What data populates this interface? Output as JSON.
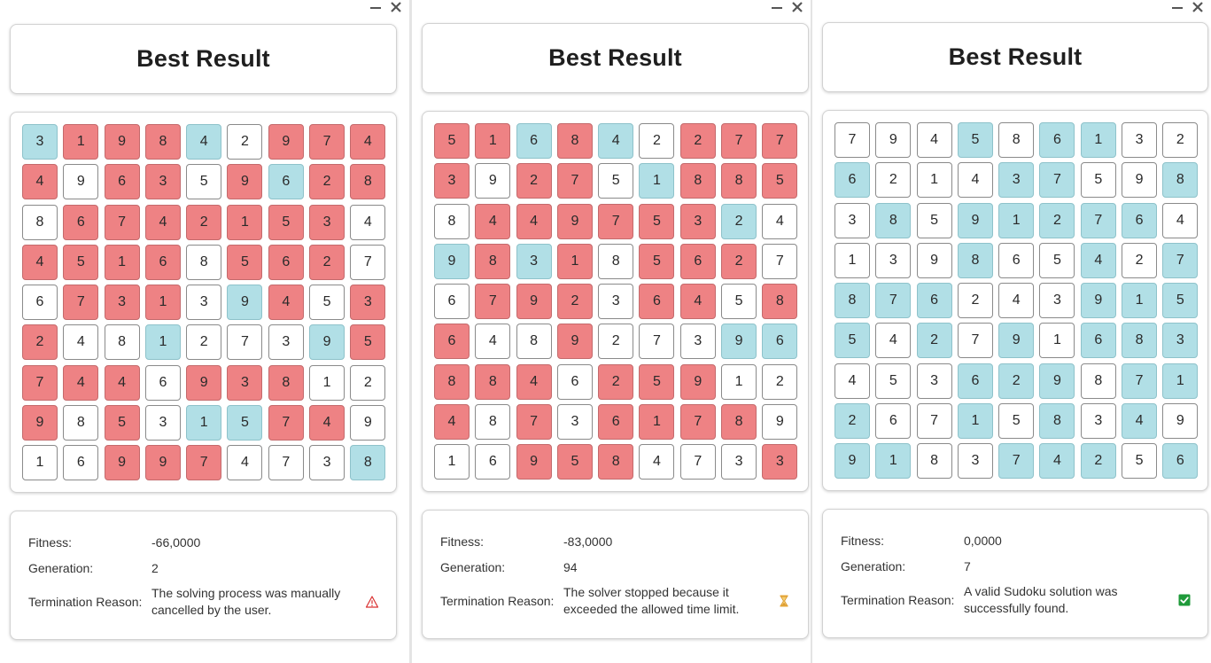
{
  "labels": {
    "fitness": "Fitness:",
    "generation": "Generation:",
    "termination": "Termination Reason:"
  },
  "colors": {
    "conflict": "#ee8284",
    "valid": "#b1dfe6",
    "plain": "#ffffff"
  },
  "panels": [
    {
      "title": "Best Result",
      "fitness": "-66,0000",
      "generation": "2",
      "reason_line1": "The solving process was manually",
      "reason_line2": "cancelled by the user.",
      "status_icon": "warning-icon",
      "grid": [
        [
          3,
          1,
          9,
          8,
          4,
          2,
          9,
          7,
          4
        ],
        [
          4,
          9,
          6,
          3,
          5,
          9,
          6,
          2,
          8
        ],
        [
          8,
          6,
          7,
          4,
          2,
          1,
          5,
          3,
          4
        ],
        [
          4,
          5,
          1,
          6,
          8,
          5,
          6,
          2,
          7
        ],
        [
          6,
          7,
          3,
          1,
          3,
          9,
          4,
          5,
          3
        ],
        [
          2,
          4,
          8,
          1,
          2,
          7,
          3,
          9,
          5
        ],
        [
          7,
          4,
          4,
          6,
          9,
          3,
          8,
          1,
          2
        ],
        [
          9,
          8,
          5,
          3,
          1,
          5,
          7,
          4,
          9
        ],
        [
          1,
          6,
          9,
          9,
          7,
          4,
          7,
          3,
          8
        ]
      ],
      "states": [
        [
          "o",
          "b",
          "b",
          "b",
          "o",
          "w",
          "b",
          "b",
          "b"
        ],
        [
          "b",
          "w",
          "b",
          "b",
          "w",
          "b",
          "o",
          "b",
          "b"
        ],
        [
          "w",
          "b",
          "b",
          "b",
          "b",
          "b",
          "b",
          "b",
          "w"
        ],
        [
          "b",
          "b",
          "b",
          "b",
          "w",
          "b",
          "b",
          "b",
          "w"
        ],
        [
          "w",
          "b",
          "b",
          "b",
          "w",
          "o",
          "b",
          "w",
          "b"
        ],
        [
          "b",
          "w",
          "w",
          "o",
          "w",
          "w",
          "w",
          "o",
          "b"
        ],
        [
          "b",
          "b",
          "b",
          "w",
          "b",
          "b",
          "b",
          "w",
          "w"
        ],
        [
          "b",
          "w",
          "b",
          "w",
          "o",
          "o",
          "b",
          "b",
          "w"
        ],
        [
          "w",
          "w",
          "b",
          "b",
          "b",
          "w",
          "w",
          "w",
          "o"
        ]
      ]
    },
    {
      "title": "Best Result",
      "fitness": "-83,0000",
      "generation": "94",
      "reason_line1": "The solver stopped because it",
      "reason_line2": "exceeded the allowed time limit.",
      "status_icon": "hourglass-icon",
      "grid": [
        [
          5,
          1,
          6,
          8,
          4,
          2,
          2,
          7,
          7
        ],
        [
          3,
          9,
          2,
          7,
          5,
          1,
          8,
          8,
          5
        ],
        [
          8,
          4,
          4,
          9,
          7,
          5,
          3,
          2,
          4
        ],
        [
          9,
          8,
          3,
          1,
          8,
          5,
          6,
          2,
          7
        ],
        [
          6,
          7,
          9,
          2,
          3,
          6,
          4,
          5,
          8
        ],
        [
          6,
          4,
          8,
          9,
          2,
          7,
          3,
          9,
          6
        ],
        [
          8,
          8,
          4,
          6,
          2,
          5,
          9,
          1,
          2
        ],
        [
          4,
          8,
          7,
          3,
          6,
          1,
          7,
          8,
          9
        ],
        [
          1,
          6,
          9,
          5,
          8,
          4,
          7,
          3,
          3
        ]
      ],
      "states": [
        [
          "b",
          "b",
          "o",
          "b",
          "o",
          "w",
          "b",
          "b",
          "b"
        ],
        [
          "b",
          "w",
          "b",
          "b",
          "w",
          "o",
          "b",
          "b",
          "b"
        ],
        [
          "w",
          "b",
          "b",
          "b",
          "b",
          "b",
          "b",
          "o",
          "w"
        ],
        [
          "o",
          "b",
          "o",
          "b",
          "w",
          "b",
          "b",
          "b",
          "w"
        ],
        [
          "w",
          "b",
          "b",
          "b",
          "w",
          "b",
          "b",
          "w",
          "b"
        ],
        [
          "b",
          "w",
          "w",
          "b",
          "w",
          "w",
          "w",
          "o",
          "o"
        ],
        [
          "b",
          "b",
          "b",
          "w",
          "b",
          "b",
          "b",
          "w",
          "w"
        ],
        [
          "b",
          "w",
          "b",
          "w",
          "b",
          "b",
          "b",
          "b",
          "w"
        ],
        [
          "w",
          "w",
          "b",
          "b",
          "b",
          "w",
          "w",
          "w",
          "b"
        ]
      ]
    },
    {
      "title": "Best Result",
      "fitness": "0,0000",
      "generation": "7",
      "reason_line1": "A valid Sudoku solution was",
      "reason_line2": "successfully found.",
      "status_icon": "checkmark-icon",
      "grid": [
        [
          7,
          9,
          4,
          5,
          8,
          6,
          1,
          3,
          2
        ],
        [
          6,
          2,
          1,
          4,
          3,
          7,
          5,
          9,
          8
        ],
        [
          3,
          8,
          5,
          9,
          1,
          2,
          7,
          6,
          4
        ],
        [
          1,
          3,
          9,
          8,
          6,
          5,
          4,
          2,
          7
        ],
        [
          8,
          7,
          6,
          2,
          4,
          3,
          9,
          1,
          5
        ],
        [
          5,
          4,
          2,
          7,
          9,
          1,
          6,
          8,
          3
        ],
        [
          4,
          5,
          3,
          6,
          2,
          9,
          8,
          7,
          1
        ],
        [
          2,
          6,
          7,
          1,
          5,
          8,
          3,
          4,
          9
        ],
        [
          9,
          1,
          8,
          3,
          7,
          4,
          2,
          5,
          6
        ]
      ],
      "states": [
        [
          "w",
          "w",
          "w",
          "o",
          "w",
          "o",
          "o",
          "w",
          "w"
        ],
        [
          "o",
          "w",
          "w",
          "w",
          "o",
          "o",
          "w",
          "w",
          "o"
        ],
        [
          "w",
          "o",
          "w",
          "o",
          "o",
          "o",
          "o",
          "o",
          "w"
        ],
        [
          "w",
          "w",
          "w",
          "o",
          "w",
          "w",
          "o",
          "w",
          "o"
        ],
        [
          "o",
          "o",
          "o",
          "w",
          "w",
          "w",
          "o",
          "o",
          "o"
        ],
        [
          "o",
          "w",
          "o",
          "w",
          "o",
          "w",
          "o",
          "o",
          "o"
        ],
        [
          "w",
          "w",
          "w",
          "o",
          "o",
          "o",
          "w",
          "o",
          "o"
        ],
        [
          "o",
          "w",
          "w",
          "o",
          "w",
          "o",
          "w",
          "o",
          "w"
        ],
        [
          "o",
          "o",
          "w",
          "w",
          "o",
          "o",
          "o",
          "w",
          "o"
        ]
      ]
    }
  ]
}
